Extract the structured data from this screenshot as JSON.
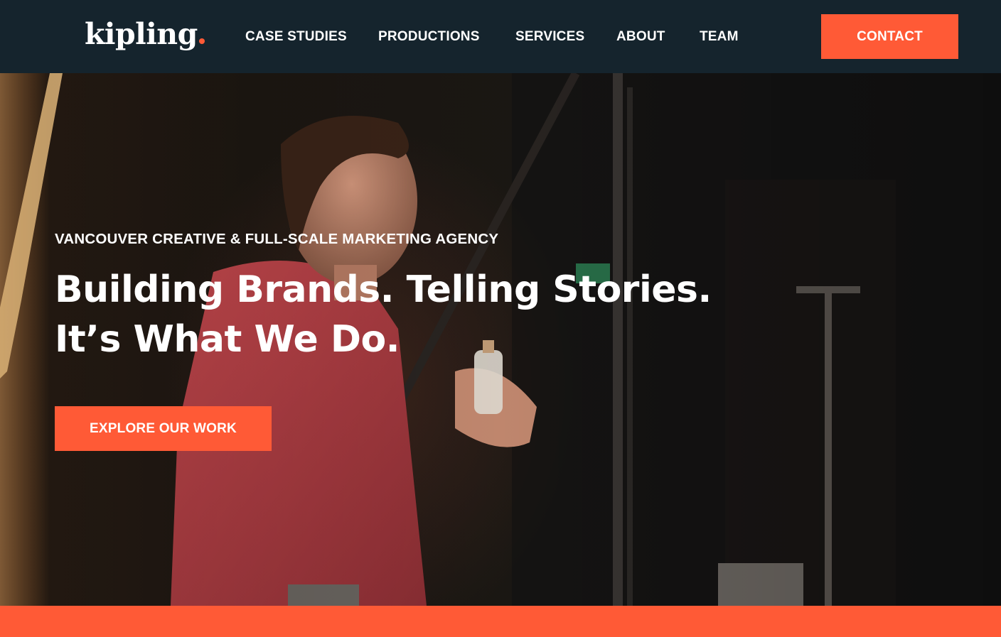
{
  "header": {
    "logo_text": "kipling",
    "nav": [
      {
        "label": "CASE STUDIES"
      },
      {
        "label": "PRODUCTIONS"
      },
      {
        "label": "SERVICES"
      },
      {
        "label": "ABOUT"
      },
      {
        "label": "TEAM"
      }
    ],
    "contact_label": "CONTACT"
  },
  "hero": {
    "eyebrow": "VANCOUVER CREATIVE & FULL-SCALE MARKETING AGENCY",
    "headline_line1": "Building Brands. Telling Stories.",
    "headline_line2": "It’s What We Do.",
    "cta_label": "EXPLORE OUR WORK"
  },
  "colors": {
    "header_bg": "#15242d",
    "accent": "#ff5a36",
    "text": "#ffffff"
  },
  "icons": [
    "logo-dot-icon"
  ]
}
